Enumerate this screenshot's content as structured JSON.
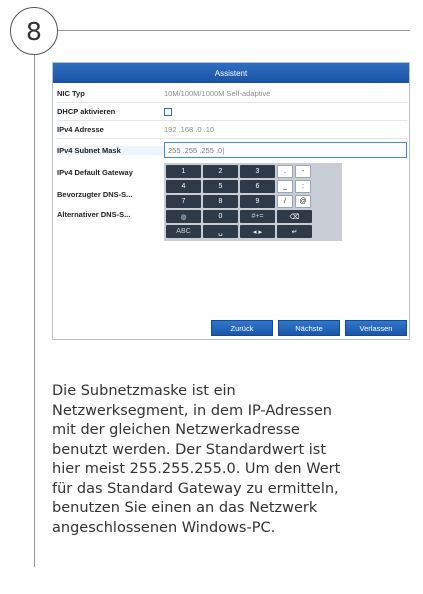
{
  "step": {
    "number": "8"
  },
  "dialog": {
    "title": "Assistent",
    "fields": [
      {
        "label": "NIC Typ",
        "value": "10M/100M/1000M Self-adaptive"
      },
      {
        "label": "DHCP aktivieren",
        "value": ""
      },
      {
        "label": "IPv4 Adresse",
        "value": "192 .168 .0   .10"
      },
      {
        "label": "IPv4 Subnet Mask",
        "value": "255 .255 .255 .0|"
      },
      {
        "label": "IPv4 Default Gateway",
        "value": ""
      },
      {
        "label": "Bevorzugter DNS-S...",
        "value": ""
      },
      {
        "label": "Alternativer DNS-S...",
        "value": ""
      }
    ],
    "keyboard": {
      "rows": [
        [
          "1",
          "2",
          "3",
          ".",
          "-"
        ],
        [
          "4",
          "5",
          "6",
          "_",
          ":"
        ],
        [
          "7",
          "8",
          "9",
          "/",
          "@"
        ],
        [
          "◍",
          "0",
          "#+=",
          "⌫"
        ],
        [
          "ABC",
          "␣",
          "◂ ▸",
          "↵"
        ]
      ]
    },
    "buttons": {
      "back": "Zurück",
      "next": "Nächste",
      "exit": "Verlassen"
    }
  },
  "caption": {
    "lines": [
      "Die Subnetzmaske ist ein",
      "Netzwerksegment, in dem IP-Adressen",
      "mit der gleichen Netzwerkadresse",
      "benutzt werden. Der Standardwert ist",
      "hier meist 255.255.255.0. Um den Wert",
      "für das Standard Gateway zu ermitteln,",
      "benutzen Sie einen an das Netzwerk",
      "angeschlossenen Windows-PC."
    ]
  }
}
